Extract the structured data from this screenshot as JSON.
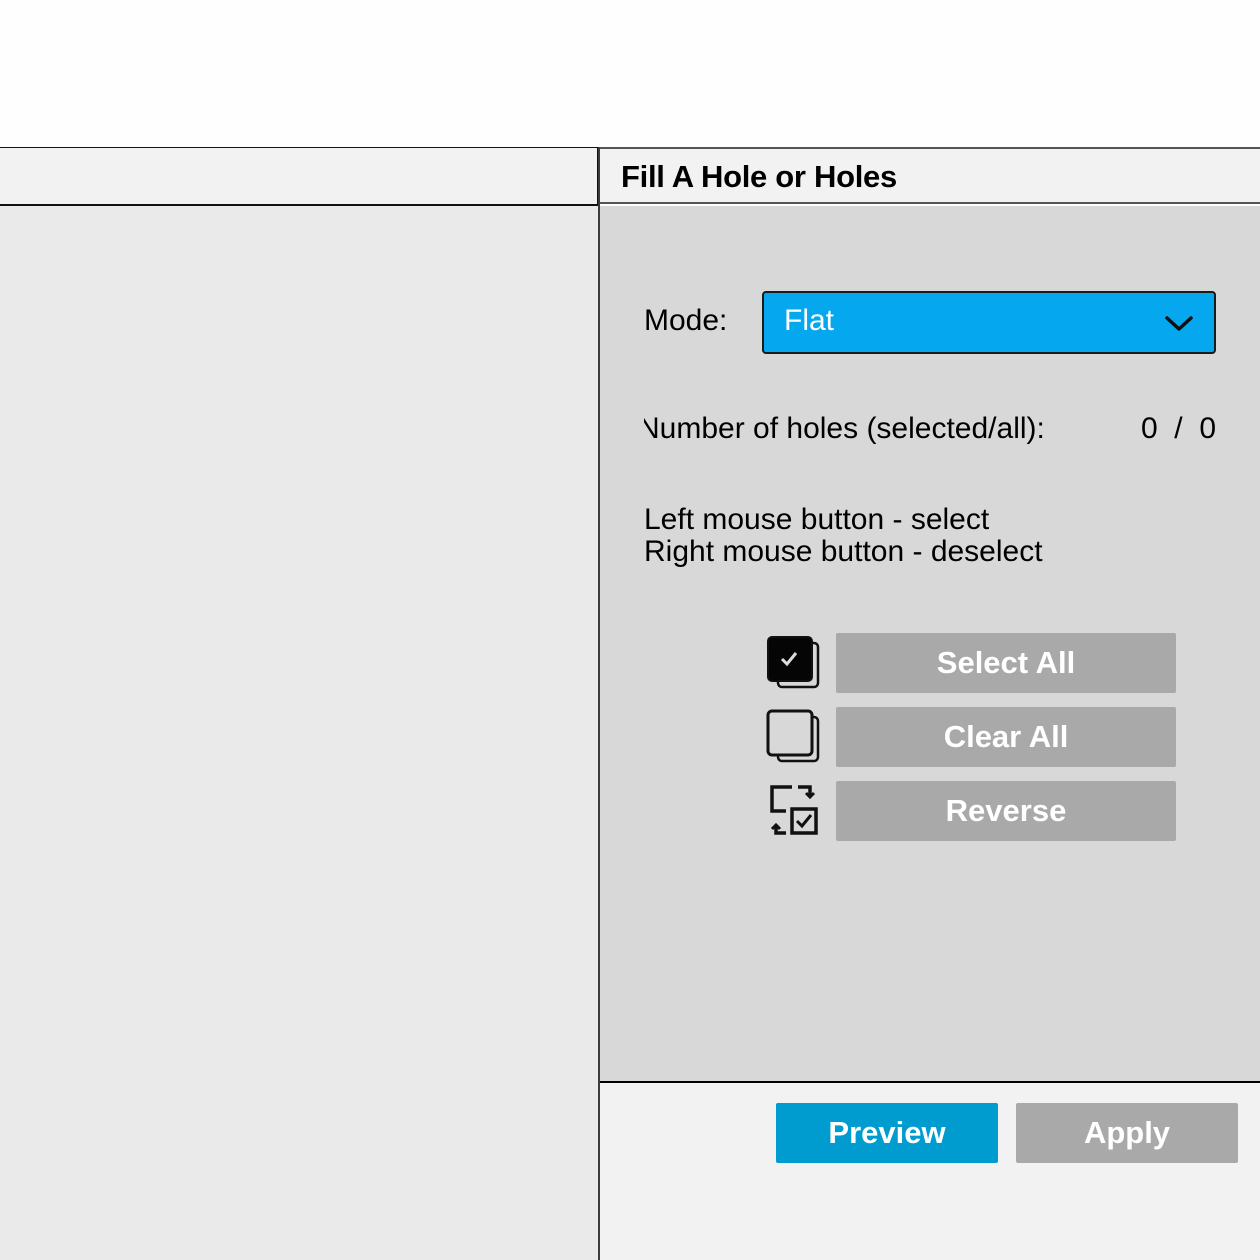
{
  "panel": {
    "title": "Fill A Hole or Holes",
    "mode": {
      "label": "Mode:",
      "value": "Flat",
      "icon": "chevron-down-icon"
    },
    "holes": {
      "label": "Number of holes (selected/all):",
      "selected": "0",
      "all": "0",
      "display": "0  /  0"
    },
    "hints": [
      "Left mouse button - select",
      "Right mouse button - deselect"
    ],
    "actions": [
      {
        "label": "Select All",
        "icon": "select-all-checkbox-icon"
      },
      {
        "label": "Clear All",
        "icon": "clear-all-checkbox-icon"
      },
      {
        "label": "Reverse",
        "icon": "reverse-selection-icon"
      }
    ]
  },
  "footer": {
    "preview_label": "Preview",
    "apply_label": "Apply"
  },
  "colors": {
    "accent_select": "#05a8ee",
    "preview_button": "#009bcf",
    "disabled_button": "#a9a9a9",
    "panel_bg": "#d8d8d8",
    "header_bg": "#f2f2f2"
  }
}
